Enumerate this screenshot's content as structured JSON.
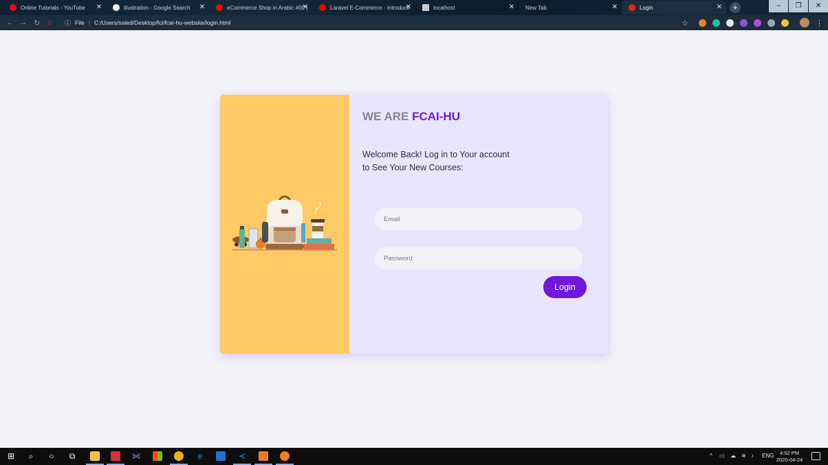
{
  "browser": {
    "tabs": [
      {
        "title": "Online Tutorials - YouTube",
        "favicon": "youtube-icon",
        "color": "#ff0000"
      },
      {
        "title": "illustration - Google Search",
        "favicon": "google-icon",
        "color": "#ffffff"
      },
      {
        "title": "eCommerce Shop in Arabic #00 |",
        "favicon": "youtube-icon",
        "color": "#ff0000"
      },
      {
        "title": "Laravel E-Commerce - Introducti",
        "favicon": "youtube-icon",
        "color": "#ff0000"
      },
      {
        "title": "localhost",
        "favicon": "document-icon",
        "color": "#c8ccd0"
      },
      {
        "title": "New Tab",
        "favicon": "",
        "color": ""
      },
      {
        "title": "Login",
        "favicon": "site-icon",
        "color": "#e2241b"
      }
    ],
    "active_tab": "Login",
    "new_tab_label": "+",
    "window_buttons": {
      "minimize": "–",
      "restore": "❐",
      "close": "✕"
    },
    "address": {
      "scheme_label": "File",
      "url": "C:/Users/saied/Desktop/fci/fcai-hu-website/login.html"
    }
  },
  "card": {
    "heading_prefix": "WE ARE",
    "heading_brand": "FCAI-HU",
    "welcome_line1": "Welcome Back! Log in to Your account",
    "welcome_line2": "to See Your New Courses:",
    "email_placeholder": "Email",
    "password_placeholder": "Password",
    "login_label": "Login",
    "colors": {
      "brand": "#6f16dc",
      "illustration_panel": "#ffc966",
      "form_panel": "#e9e5fc"
    }
  },
  "taskbar": {
    "tray_text": "ENG",
    "clock_time": "4:52 PM",
    "clock_date": "2020-04-24"
  }
}
